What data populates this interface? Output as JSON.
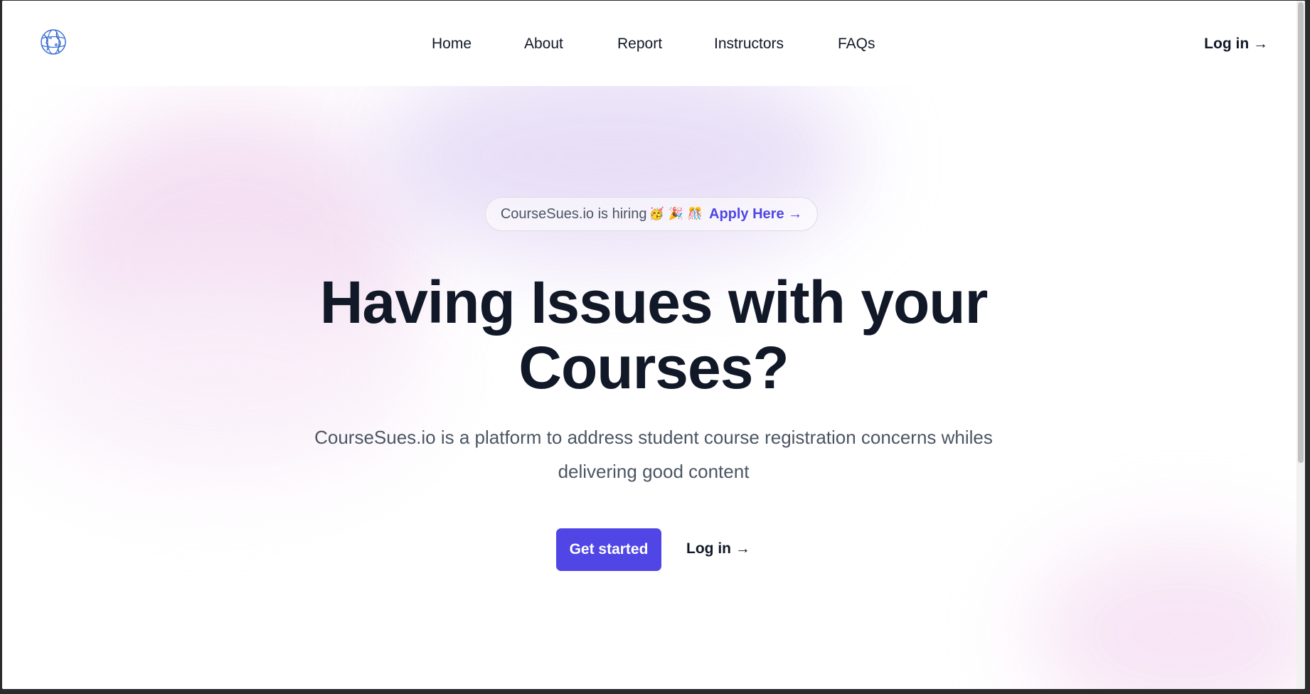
{
  "header": {
    "logo_icon": "globe-logo-icon",
    "nav": [
      "Home",
      "About",
      "Report",
      "Instructors",
      "FAQs"
    ],
    "login": "Log in →"
  },
  "hero": {
    "badge_text": "CourseSues.io is hiring",
    "badge_emojis": [
      "🥳",
      "🎉",
      "🎊"
    ],
    "badge_link": "Apply Here →",
    "headline_line1": "Having Issues with your",
    "headline_line2": "Courses?",
    "subtitle": "CourseSues.io is a platform to address student course registration concerns whiles delivering good content",
    "primary_cta": "Get started",
    "secondary_cta": "Log in →"
  },
  "colors": {
    "accent": "#4f46e5",
    "heading": "#111827",
    "body_text": "#4b5563"
  }
}
